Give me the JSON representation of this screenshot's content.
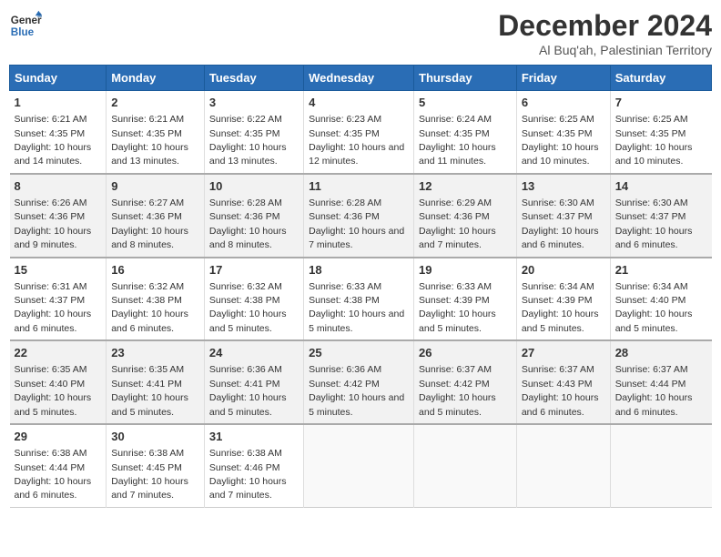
{
  "logo": {
    "line1": "General",
    "line2": "Blue"
  },
  "title": "December 2024",
  "subtitle": "Al Buq'ah, Palestinian Territory",
  "days_header": [
    "Sunday",
    "Monday",
    "Tuesday",
    "Wednesday",
    "Thursday",
    "Friday",
    "Saturday"
  ],
  "weeks": [
    [
      {
        "num": "1",
        "sunrise": "6:21 AM",
        "sunset": "4:35 PM",
        "daylight": "10 hours and 14 minutes."
      },
      {
        "num": "2",
        "sunrise": "6:21 AM",
        "sunset": "4:35 PM",
        "daylight": "10 hours and 13 minutes."
      },
      {
        "num": "3",
        "sunrise": "6:22 AM",
        "sunset": "4:35 PM",
        "daylight": "10 hours and 13 minutes."
      },
      {
        "num": "4",
        "sunrise": "6:23 AM",
        "sunset": "4:35 PM",
        "daylight": "10 hours and 12 minutes."
      },
      {
        "num": "5",
        "sunrise": "6:24 AM",
        "sunset": "4:35 PM",
        "daylight": "10 hours and 11 minutes."
      },
      {
        "num": "6",
        "sunrise": "6:25 AM",
        "sunset": "4:35 PM",
        "daylight": "10 hours and 10 minutes."
      },
      {
        "num": "7",
        "sunrise": "6:25 AM",
        "sunset": "4:35 PM",
        "daylight": "10 hours and 10 minutes."
      }
    ],
    [
      {
        "num": "8",
        "sunrise": "6:26 AM",
        "sunset": "4:36 PM",
        "daylight": "10 hours and 9 minutes."
      },
      {
        "num": "9",
        "sunrise": "6:27 AM",
        "sunset": "4:36 PM",
        "daylight": "10 hours and 8 minutes."
      },
      {
        "num": "10",
        "sunrise": "6:28 AM",
        "sunset": "4:36 PM",
        "daylight": "10 hours and 8 minutes."
      },
      {
        "num": "11",
        "sunrise": "6:28 AM",
        "sunset": "4:36 PM",
        "daylight": "10 hours and 7 minutes."
      },
      {
        "num": "12",
        "sunrise": "6:29 AM",
        "sunset": "4:36 PM",
        "daylight": "10 hours and 7 minutes."
      },
      {
        "num": "13",
        "sunrise": "6:30 AM",
        "sunset": "4:37 PM",
        "daylight": "10 hours and 6 minutes."
      },
      {
        "num": "14",
        "sunrise": "6:30 AM",
        "sunset": "4:37 PM",
        "daylight": "10 hours and 6 minutes."
      }
    ],
    [
      {
        "num": "15",
        "sunrise": "6:31 AM",
        "sunset": "4:37 PM",
        "daylight": "10 hours and 6 minutes."
      },
      {
        "num": "16",
        "sunrise": "6:32 AM",
        "sunset": "4:38 PM",
        "daylight": "10 hours and 6 minutes."
      },
      {
        "num": "17",
        "sunrise": "6:32 AM",
        "sunset": "4:38 PM",
        "daylight": "10 hours and 5 minutes."
      },
      {
        "num": "18",
        "sunrise": "6:33 AM",
        "sunset": "4:38 PM",
        "daylight": "10 hours and 5 minutes."
      },
      {
        "num": "19",
        "sunrise": "6:33 AM",
        "sunset": "4:39 PM",
        "daylight": "10 hours and 5 minutes."
      },
      {
        "num": "20",
        "sunrise": "6:34 AM",
        "sunset": "4:39 PM",
        "daylight": "10 hours and 5 minutes."
      },
      {
        "num": "21",
        "sunrise": "6:34 AM",
        "sunset": "4:40 PM",
        "daylight": "10 hours and 5 minutes."
      }
    ],
    [
      {
        "num": "22",
        "sunrise": "6:35 AM",
        "sunset": "4:40 PM",
        "daylight": "10 hours and 5 minutes."
      },
      {
        "num": "23",
        "sunrise": "6:35 AM",
        "sunset": "4:41 PM",
        "daylight": "10 hours and 5 minutes."
      },
      {
        "num": "24",
        "sunrise": "6:36 AM",
        "sunset": "4:41 PM",
        "daylight": "10 hours and 5 minutes."
      },
      {
        "num": "25",
        "sunrise": "6:36 AM",
        "sunset": "4:42 PM",
        "daylight": "10 hours and 5 minutes."
      },
      {
        "num": "26",
        "sunrise": "6:37 AM",
        "sunset": "4:42 PM",
        "daylight": "10 hours and 5 minutes."
      },
      {
        "num": "27",
        "sunrise": "6:37 AM",
        "sunset": "4:43 PM",
        "daylight": "10 hours and 6 minutes."
      },
      {
        "num": "28",
        "sunrise": "6:37 AM",
        "sunset": "4:44 PM",
        "daylight": "10 hours and 6 minutes."
      }
    ],
    [
      {
        "num": "29",
        "sunrise": "6:38 AM",
        "sunset": "4:44 PM",
        "daylight": "10 hours and 6 minutes."
      },
      {
        "num": "30",
        "sunrise": "6:38 AM",
        "sunset": "4:45 PM",
        "daylight": "10 hours and 7 minutes."
      },
      {
        "num": "31",
        "sunrise": "6:38 AM",
        "sunset": "4:46 PM",
        "daylight": "10 hours and 7 minutes."
      },
      null,
      null,
      null,
      null
    ]
  ]
}
